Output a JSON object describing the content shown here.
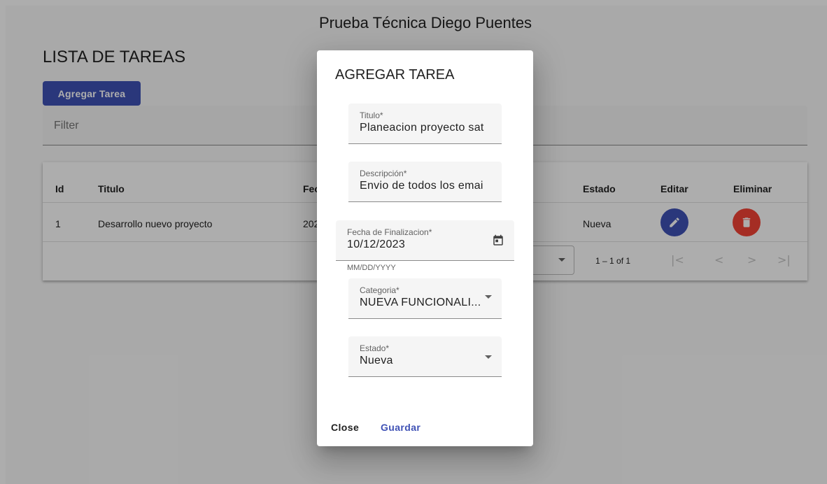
{
  "app": {
    "title": "Prueba Técnica Diego Puentes"
  },
  "list": {
    "heading": "LISTA DE TAREAS",
    "add_button": "Agregar Tarea",
    "filter_placeholder": "Filter"
  },
  "table": {
    "headers": [
      "Id",
      "Titulo",
      "Fec",
      "Estado",
      "Editar",
      "Eliminar"
    ],
    "rows": [
      {
        "id": "1",
        "titulo": "Desarrollo nuevo proyecto",
        "fecha": "202",
        "estado": "Nueva"
      }
    ],
    "paginator": {
      "range": "1 – 1 of 1"
    }
  },
  "dialog": {
    "title": "AGREGAR TAREA",
    "fields": {
      "titulo": {
        "label": "Titulo*",
        "value": "Planeacion proyecto sat"
      },
      "descripcion": {
        "label": "Descripción*",
        "value": "Envio de todos los emai"
      },
      "fecha": {
        "label": "Fecha de Finalizacion*",
        "value": "10/12/2023",
        "hint": "MM/DD/YYYY"
      },
      "categoria": {
        "label": "Categoria*",
        "value": "NUEVA FUNCIONALI..."
      },
      "estado": {
        "label": "Estado*",
        "value": "Nueva"
      }
    },
    "actions": {
      "close": "Close",
      "save": "Guardar"
    }
  },
  "icons": {
    "edit": "pencil-icon",
    "delete": "trash-icon",
    "calendar": "calendar-icon",
    "first_page": "first-page-icon",
    "prev_page": "chevron-left-icon",
    "next_page": "chevron-right-icon",
    "last_page": "last-page-icon"
  },
  "colors": {
    "primary": "#3f51b5",
    "warn": "#f44336",
    "backdrop": "rgba(0,0,0,0.32)"
  }
}
